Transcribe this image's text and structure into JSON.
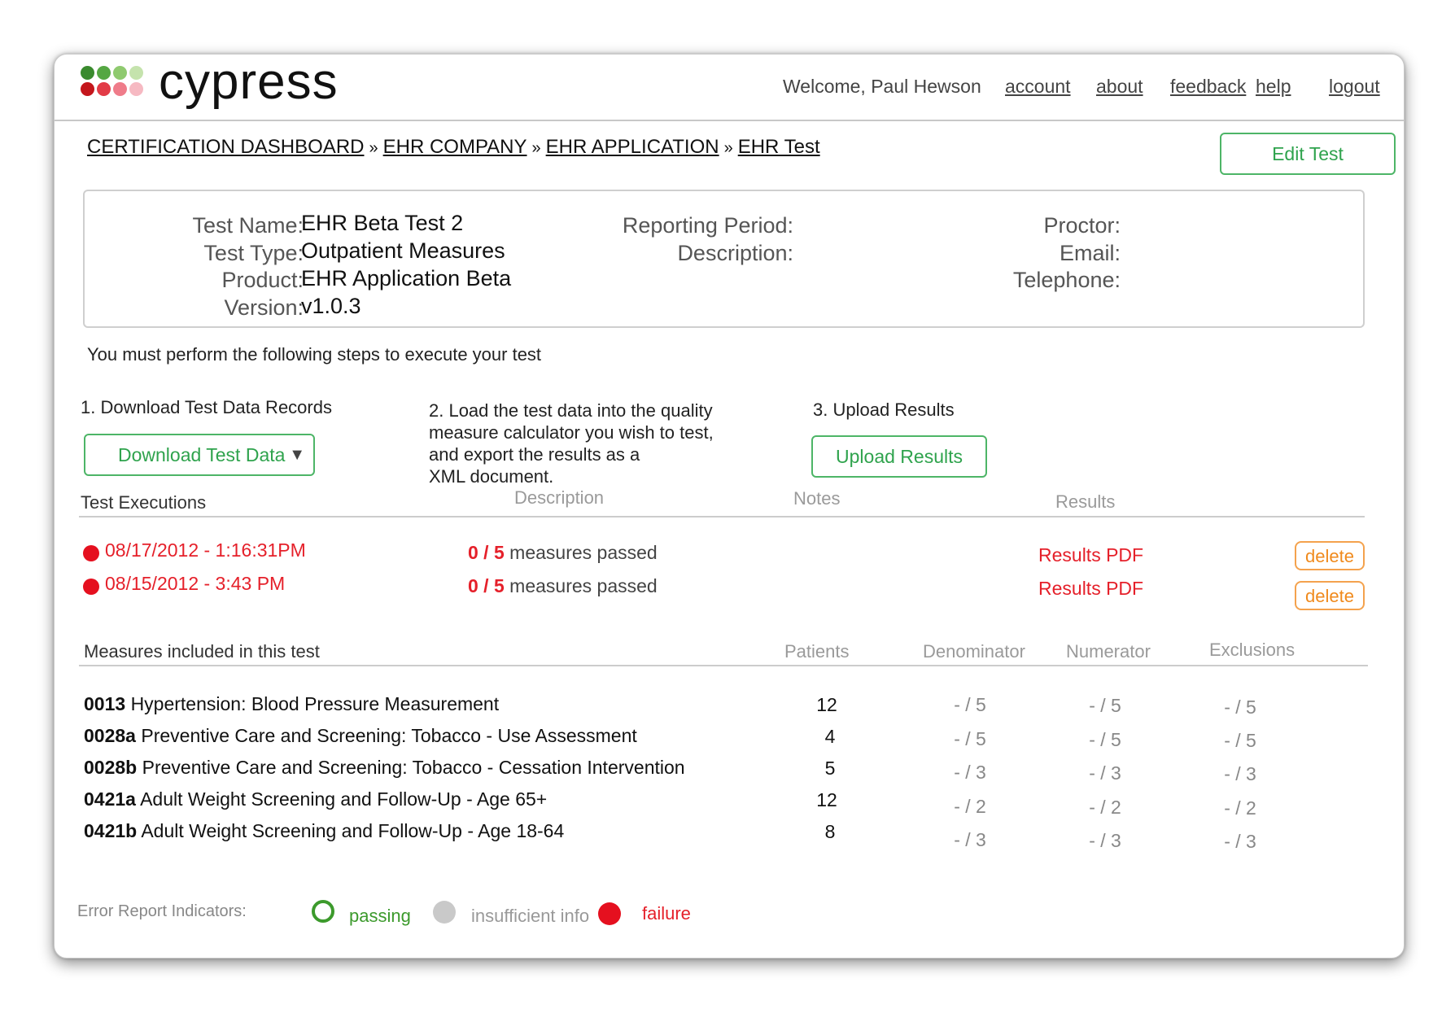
{
  "app": {
    "name": "cypress"
  },
  "header": {
    "welcome": "Welcome, Paul Hewson",
    "links": [
      "account",
      "about",
      "feedback",
      "help",
      "logout"
    ]
  },
  "breadcrumb": [
    "CERTIFICATION DASHBOARD",
    "EHR COMPANY",
    "EHR APPLICATION",
    "EHR Test"
  ],
  "breadcrumb_sep": "»",
  "edit_test_label": "Edit Test",
  "info": {
    "test_name_label": "Test Name:",
    "test_name": "EHR Beta Test 2",
    "test_type_label": "Test Type:",
    "test_type": "Outpatient Measures",
    "product_label": "Product:",
    "product": "EHR Application Beta",
    "version_label": "Version:",
    "version": "v1.0.3",
    "reporting_period_label": "Reporting Period:",
    "description_label": "Description:",
    "proctor_label": "Proctor:",
    "email_label": "Email:",
    "telephone_label": "Telephone:"
  },
  "steps": {
    "intro": "You must perform the following steps to execute your test",
    "step1": "1. Download Test Data Records",
    "download_label": "Download Test Data",
    "step2_lines": [
      "2. Load the test data into the quality",
      "measure calculator you wish to test,",
      "and export the results as a",
      "XML document."
    ],
    "step3": "3. Upload Results",
    "upload_label": "Upload Results"
  },
  "executions": {
    "headers": {
      "title": "Test Executions",
      "description": "Description",
      "notes": "Notes",
      "results": "Results"
    },
    "rows": [
      {
        "date": "08/17/2012 - 1:16:31PM",
        "score": "0 / 5",
        "text": "measures passed",
        "results": "Results PDF",
        "delete": "delete"
      },
      {
        "date": "08/15/2012 - 3:43 PM",
        "score": "0 / 5",
        "text": "measures passed",
        "results": "Results PDF",
        "delete": "delete"
      }
    ]
  },
  "measures": {
    "headers": {
      "title": "Measures included in this test",
      "patients": "Patients",
      "denominator": "Denominator",
      "numerator": "Numerator",
      "exclusions": "Exclusions"
    },
    "rows": [
      {
        "id": "0013",
        "name": "Hypertension: Blood Pressure Measurement",
        "patients": "12",
        "denominator": "- / 5",
        "numerator": "- / 5",
        "exclusions": "- / 5"
      },
      {
        "id": "0028a",
        "name": "Preventive Care and Screening: Tobacco - Use Assessment",
        "patients": "4",
        "denominator": "- / 5",
        "numerator": "- / 5",
        "exclusions": "- / 5"
      },
      {
        "id": "0028b",
        "name": "Preventive Care and Screening: Tobacco - Cessation Intervention",
        "patients": "5",
        "denominator": "- / 3",
        "numerator": "- / 3",
        "exclusions": "- / 3"
      },
      {
        "id": "0421a",
        "name": "Adult Weight Screening and Follow-Up - Age 65+",
        "patients": "12",
        "denominator": "- / 2",
        "numerator": "- / 2",
        "exclusions": "- / 2"
      },
      {
        "id": "0421b",
        "name": "Adult Weight Screening and Follow-Up - Age 18-64",
        "patients": "8",
        "denominator": "- / 3",
        "numerator": "- / 3",
        "exclusions": "- / 3"
      }
    ]
  },
  "legend": {
    "title": "Error Report Indicators:",
    "passing": "passing",
    "insufficient": "insufficient info",
    "failure": "failure"
  },
  "colors": {
    "green": "#2fa34d",
    "red": "#e5202a",
    "orange": "#f08a1c",
    "grey": "#c9c9c9"
  }
}
